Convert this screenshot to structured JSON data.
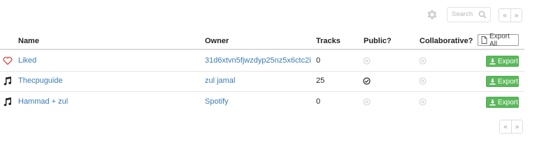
{
  "toolbar": {
    "settings_icon": "gear-icon",
    "search": {
      "placeholder": "Search",
      "icon": "search-icon"
    },
    "pager": {
      "prev": "«",
      "next": "»"
    }
  },
  "table": {
    "headers": {
      "name": "Name",
      "owner": "Owner",
      "tracks": "Tracks",
      "public": "Public?",
      "collaborative": "Collaborative?",
      "export_all": "Export All"
    },
    "rows": [
      {
        "icon": "heart-icon",
        "name": "Liked",
        "owner": "31d6xtvn5fjwzdyp25nz5x6ctc2i",
        "tracks": "0",
        "public": false,
        "collaborative": false,
        "export": "Export"
      },
      {
        "icon": "music-note-icon",
        "name": "Thecpuguide",
        "owner": "zul jamal",
        "tracks": "25",
        "public": true,
        "collaborative": false,
        "export": "Export"
      },
      {
        "icon": "music-note-icon",
        "name": "Hammad + zul",
        "owner": "Spotify",
        "tracks": "0",
        "public": false,
        "collaborative": false,
        "export": "Export"
      }
    ]
  },
  "footer": {
    "pager": {
      "prev": "«",
      "next": "»"
    }
  },
  "colors": {
    "link": "#3a7cb5",
    "export_green": "#5cb85c",
    "heart_red": "#d9534f",
    "muted": "#cfcfcf"
  }
}
